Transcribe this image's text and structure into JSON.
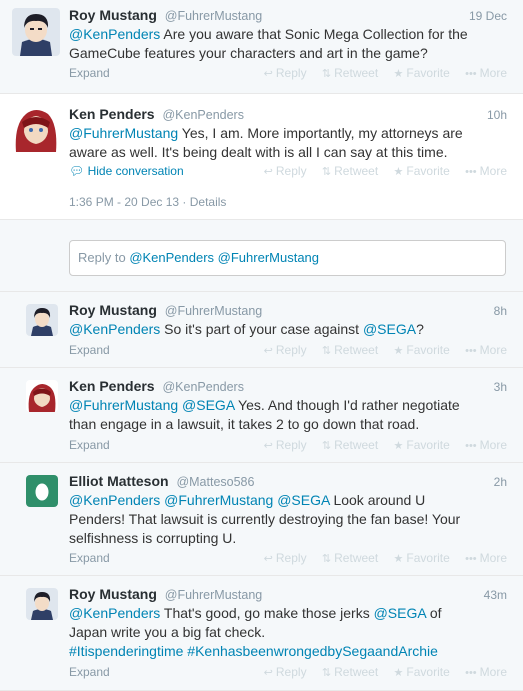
{
  "action_labels": {
    "reply": "Reply",
    "retweet": "Retweet",
    "favorite": "Favorite",
    "more": "More"
  },
  "tweets": [
    {
      "fullname": "Roy Mustang",
      "username": "@FuhrerMustang",
      "time": "19 Dec",
      "mention": "@KenPenders",
      "text": " Are you aware that Sonic Mega Collection for the GameCube features your characters and art in the game?",
      "footer": "Expand"
    },
    {
      "fullname": "Ken Penders",
      "username": "@KenPenders",
      "time": "10h",
      "mention": "@FuhrerMustang",
      "text": " Yes, I am. More importantly, my attorneys are aware as well. It's being dealt with is all I can say at this time.",
      "footer": "Hide conversation",
      "timestamp": "1:36 PM - 20 Dec 13",
      "details": "Details"
    }
  ],
  "reply_box": {
    "prefix": "Reply to ",
    "mentions": "@KenPenders @FuhrerMustang"
  },
  "replies": [
    {
      "fullname": "Roy Mustang",
      "username": "@FuhrerMustang",
      "time": "8h",
      "mention": "@KenPenders",
      "text_a": " So it's part of your case against ",
      "mention2": "@SEGA",
      "text_b": "?",
      "footer": "Expand"
    },
    {
      "fullname": "Ken Penders",
      "username": "@KenPenders",
      "time": "3h",
      "mention": "@FuhrerMustang",
      "mention2": "@SEGA",
      "text": " Yes. And though I'd rather negotiate than engage in a lawsuit, it takes 2 to go down that road.",
      "footer": "Expand"
    },
    {
      "fullname": "Elliot Matteson",
      "username": "@Matteso586",
      "time": "2h",
      "mention": "@KenPenders",
      "mention2": "@FuhrerMustang",
      "mention3": "@SEGA",
      "text": " Look around U Penders! That lawsuit is currently destroying the fan base! Your selfishness is corrupting U.",
      "footer": "Expand"
    },
    {
      "fullname": "Roy Mustang",
      "username": "@FuhrerMustang",
      "time": "43m",
      "mention": "@KenPenders",
      "text_a": " That's good, go make those jerks ",
      "mention2": "@SEGA",
      "text_b": " of Japan write you a big fat check.",
      "hashtags": "#Itispenderingtime #KenhasbeenwrongedbySegaandArchie",
      "footer": "Expand"
    }
  ]
}
